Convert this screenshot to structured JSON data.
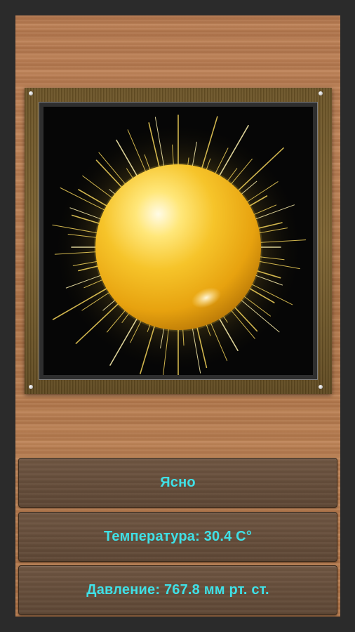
{
  "weather": {
    "condition": "Ясно",
    "temperature": "Температура: 30.4 C°",
    "pressure": "Давление: 767.8 мм рт. ст."
  },
  "icon": {
    "name": "sun-icon"
  },
  "colors": {
    "text_accent": "#3fe0e6",
    "wood": "#b97c52",
    "frame": "#6b5326",
    "screen": "#060606",
    "button": "#664e3b"
  }
}
